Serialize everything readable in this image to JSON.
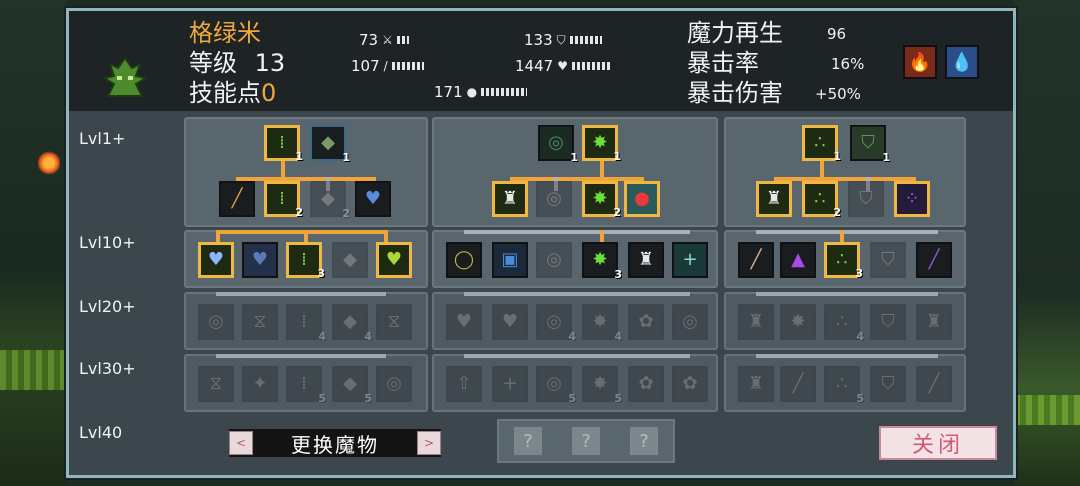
{
  "character": {
    "name": "格绿米",
    "level_label": "等级",
    "level": "13",
    "skill_points_label": "技能点",
    "skill_points": "0"
  },
  "stats": {
    "attack": "73",
    "defense": "133",
    "magic": "107",
    "hp": "1447",
    "speed": "171"
  },
  "big_stats": {
    "regen_label": "魔力再生",
    "regen": "96",
    "crit_rate_label": "暴击率",
    "crit_rate": "16%",
    "crit_dmg_label": "暴击伤害",
    "crit_dmg": "+50%"
  },
  "level_labels": [
    "Lvl1+",
    "Lvl10+",
    "Lvl20+",
    "Lvl30+",
    "Lvl40"
  ],
  "node_counts": {
    "c": "1",
    "two": "2",
    "three": "3",
    "four": "4",
    "five": "5"
  },
  "controls": {
    "switch_label": "更换魔物",
    "prev": "<",
    "next": ">",
    "unknown": "?",
    "close": "关闭"
  },
  "colors": {
    "accent": "#f0a83a",
    "panel": "#3b464d",
    "active_border": "#f0b840"
  }
}
